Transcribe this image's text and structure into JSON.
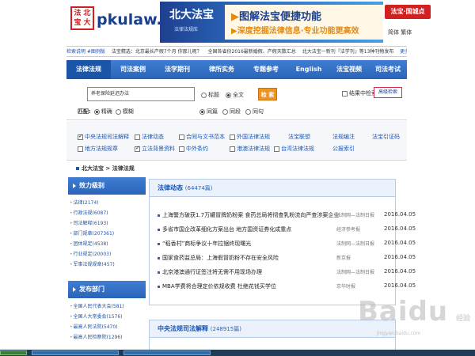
{
  "header": {
    "seal_chars": [
      "法",
      "北",
      "宝",
      "大"
    ],
    "site_name": "pkulaw.cn",
    "banner_title": "北大法宝",
    "banner_sub": "法律法规库",
    "slogan_line1": "图解法宝便捷功能",
    "slogan_line2": "深度挖掘法律信息·专业功能更高效",
    "badge": "法宝·国城点",
    "langs": "简体 繁体"
  },
  "ticker": {
    "items": [
      "检索说明 #图例版",
      "法宝精选：北京最长产假7个月 你那儿呢？",
      "全国各省份2016最新婚假、产假天数汇总",
      "北大法宝一新刊『法学刊』等13种刊物发布",
      "更多"
    ]
  },
  "nav": {
    "tabs": [
      "法律法规",
      "司法案例",
      "法学期刊",
      "律所实务",
      "专题参考",
      "English",
      "法宝视频",
      "司法考试"
    ]
  },
  "search": {
    "input_value": "养老保险延迟办法",
    "scope_options": [
      "标题",
      "全文"
    ],
    "button_label": "检 索",
    "in_results_label": "结果中检索",
    "advanced_label": "高级检索",
    "match_label": "匹配:",
    "match_options": [
      "精确",
      "模糊"
    ],
    "field_options": [
      "同篇",
      "同段",
      "同句"
    ]
  },
  "categories": [
    {
      "label": "中央法规司法解释",
      "checked": true
    },
    {
      "label": "法律动态",
      "checked": false
    },
    {
      "label": "合同与文书范本",
      "checked": false
    },
    {
      "label": "外国法律法规",
      "checked": false
    },
    {
      "label": "法宝联想",
      "checked": false,
      "box": false
    },
    {
      "label": "法规编注",
      "checked": false,
      "box": false
    },
    {
      "label": "法宝引证码",
      "checked": false,
      "box": false
    },
    {
      "label": "地方法规规章",
      "checked": false
    },
    {
      "label": "立法背景资料",
      "checked": true
    },
    {
      "label": "中外条约",
      "checked": false
    },
    {
      "label": "港澳法律法规",
      "checked": false
    },
    {
      "label": "台湾法律法规",
      "checked": false
    },
    {
      "label": "公报索引",
      "checked": false,
      "box": false
    }
  ],
  "breadcrumb": "北大法宝 > 法律法规",
  "sidebar": {
    "section1": {
      "title": "效力级别",
      "items": [
        "法律(2174)",
        "行政法规(6087)",
        "司法解释(6193)",
        "部门规章(207361)",
        "团体规定(4538)",
        "行业规定(20003)",
        "军事法规规章(457)"
      ]
    },
    "section2": {
      "title": "发布部门",
      "items": [
        "全国人民代表大会(581)",
        "全国人大常委会(1576)",
        "最高人民法院(5470)",
        "最高人民检察院(1296)"
      ]
    }
  },
  "panel1": {
    "title": "法律动态",
    "count": "(64474篇)",
    "rows": [
      {
        "title": "上海警方破获1.7万罐冒牌奶粉案 食药总局将彻查乳粉流向严查涉案企业",
        "source": "法制网—法制日报",
        "date": "2016.04.05"
      },
      {
        "title": "多省市国企改革细化方案出台 地方国资证券化成重点",
        "source": "经济参考报",
        "date": "2016.04.05"
      },
      {
        "title": "“稻香村”商标争议十年拉锯终现曙光",
        "source": "法制网—法制日报",
        "date": "2016.04.05"
      },
      {
        "title": "国家食药监总局：上海假冒奶粉不存在安全风险",
        "source": "新京报",
        "date": "2016.04.05"
      },
      {
        "title": "北京港澳通行证签注将无需不用现场办理",
        "source": "法制网—法制日报",
        "date": "2016.04.05"
      },
      {
        "title": "MBA学费将合理定价依规收费 杜绝花钱买学位",
        "source": "京华时报",
        "date": "2016.04.05"
      }
    ]
  },
  "panel2": {
    "title": "中央法规司法解释",
    "count": "(248915篇)"
  },
  "watermark": {
    "text": "Baidu",
    "sub": "经验",
    "url": "jingyan.baidu.com"
  }
}
